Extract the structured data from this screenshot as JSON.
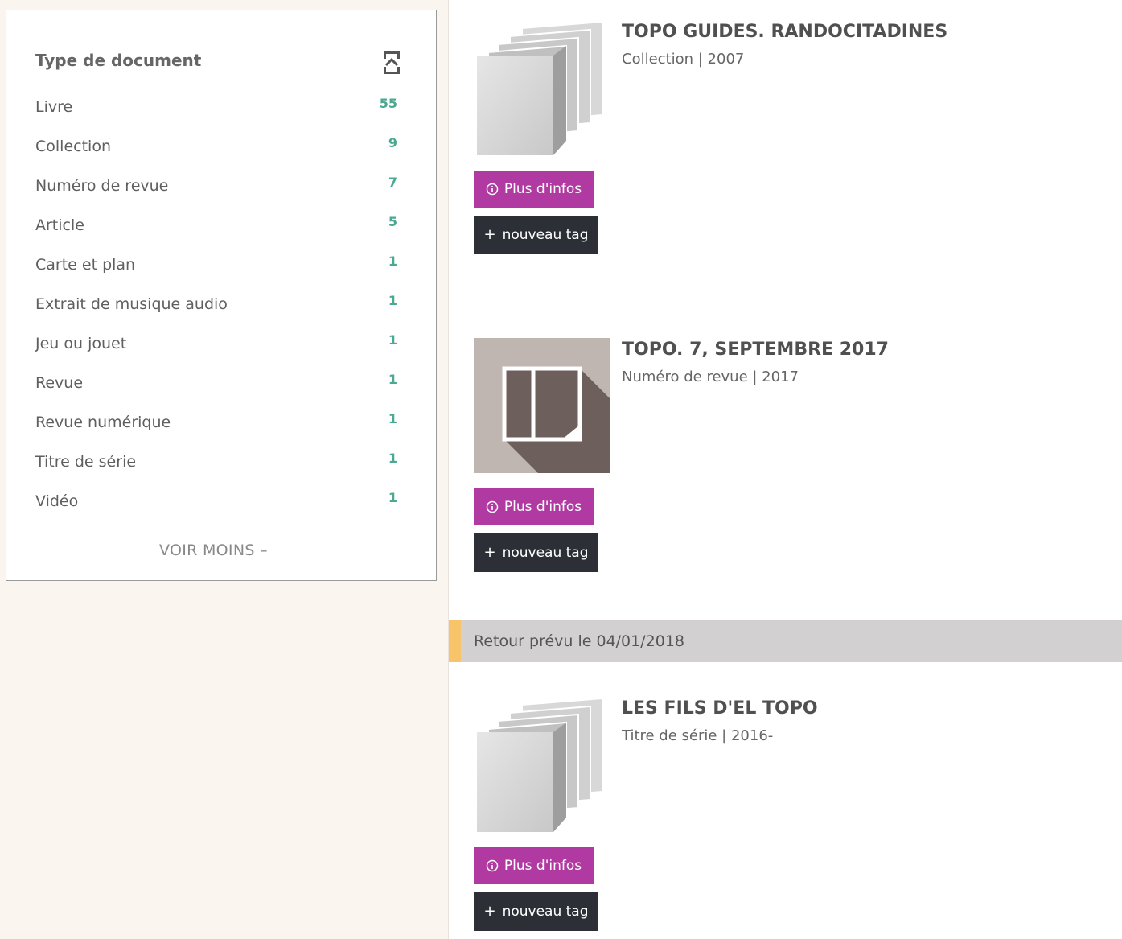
{
  "facet": {
    "title": "Type de document",
    "items": [
      {
        "label": "Livre",
        "count": "55"
      },
      {
        "label": "Collection",
        "count": "9"
      },
      {
        "label": "Numéro de revue",
        "count": "7"
      },
      {
        "label": "Article",
        "count": "5"
      },
      {
        "label": "Carte et plan",
        "count": "1"
      },
      {
        "label": "Extrait de musique audio",
        "count": "1"
      },
      {
        "label": "Jeu ou jouet",
        "count": "1"
      },
      {
        "label": "Revue",
        "count": "1"
      },
      {
        "label": "Revue numérique",
        "count": "1"
      },
      {
        "label": "Titre de série",
        "count": "1"
      },
      {
        "label": "Vidéo",
        "count": "1"
      }
    ],
    "toggle_label": "VOIR MOINS –",
    "accent_color": "#4ba891"
  },
  "results": [
    {
      "title": "TOPO GUIDES. RANDOCITADINES",
      "meta": "Collection | 2007",
      "cover_icon": "collection-stack-icon"
    },
    {
      "title": "TOPO. 7, SEPTEMBRE 2017",
      "meta": "Numéro de revue | 2017",
      "cover_icon": "magazine-issue-icon"
    },
    {
      "title": "LES FILS D'EL TOPO",
      "meta": "Titre de série | 2016-",
      "cover_icon": "collection-stack-icon"
    }
  ],
  "buttons": {
    "info_label": "Plus d'infos",
    "tag_label": "nouveau tag",
    "info_color": "#b03aa1",
    "tag_color": "#2c3036"
  },
  "banner": {
    "text": "Retour prévu le 04/01/2018",
    "accent_color": "#f7c46a"
  }
}
